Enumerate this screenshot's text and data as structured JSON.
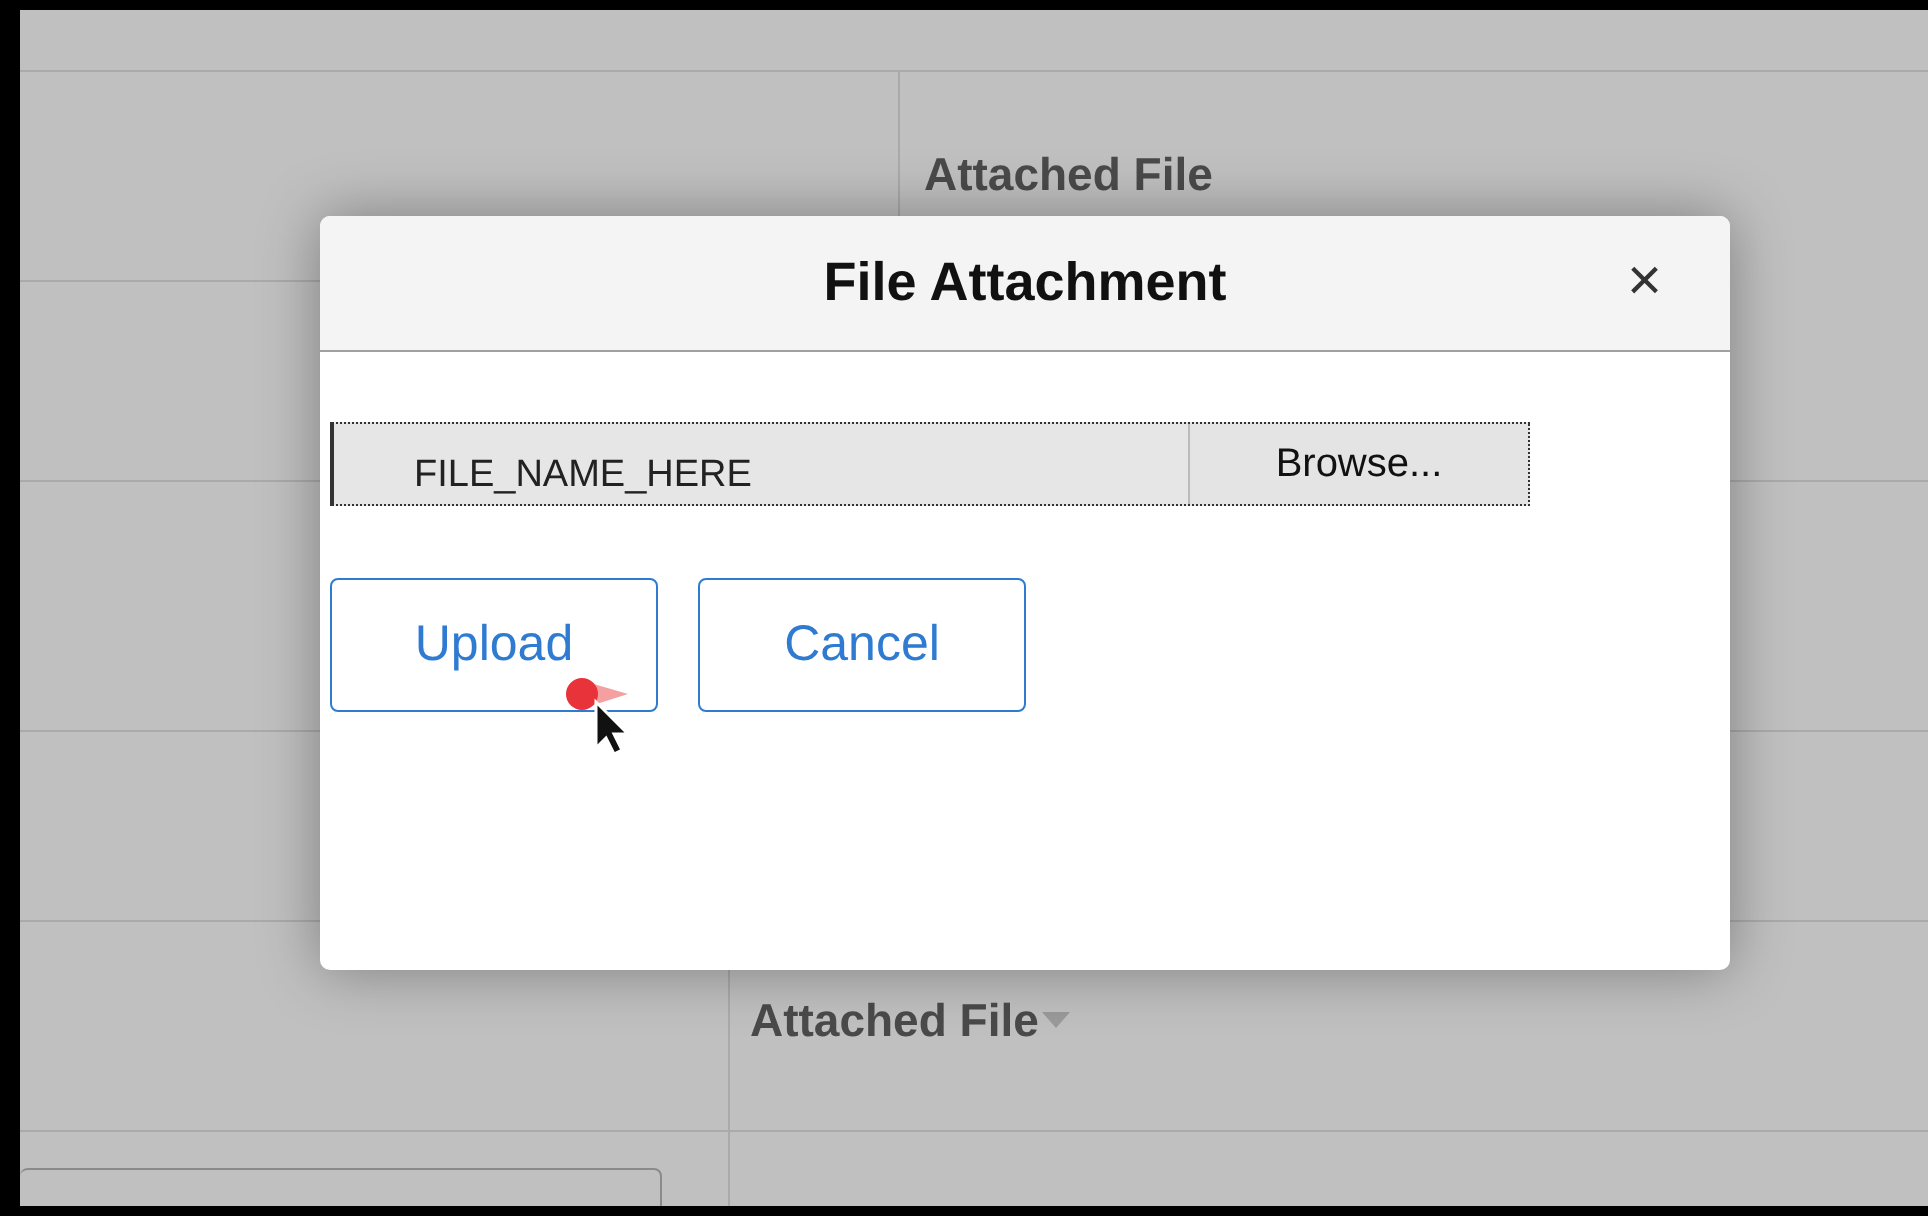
{
  "background": {
    "headers": [
      {
        "label": "Attached File",
        "kind": "plain"
      },
      {
        "label": "Attached File",
        "kind": "sortable"
      }
    ]
  },
  "dialog": {
    "title": "File Attachment",
    "close": "×",
    "file_field": {
      "value": "FILE_NAME_HERE",
      "button": "Browse..."
    },
    "buttons": [
      "Upload",
      "Cancel"
    ]
  }
}
